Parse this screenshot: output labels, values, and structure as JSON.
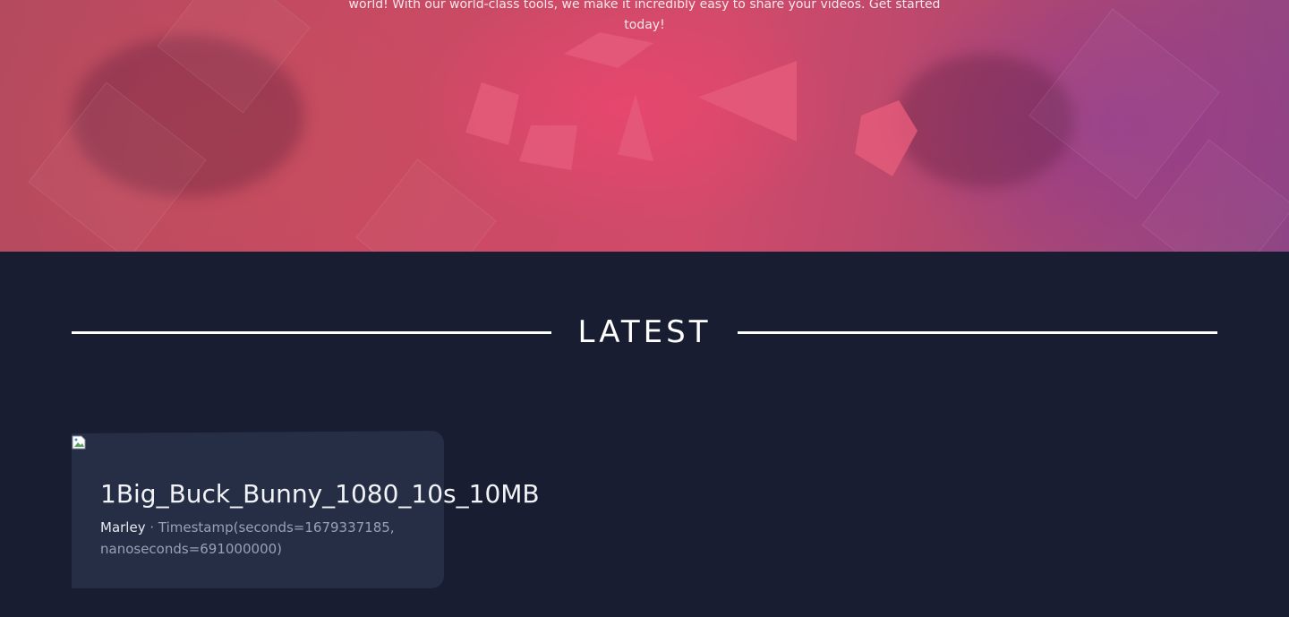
{
  "hero": {
    "description_line1": "world! With our world-class tools, we make it incredibly easy to share your videos. Get started",
    "description_line2": "today!"
  },
  "latest": {
    "heading": "LATEST"
  },
  "videos": [
    {
      "title": "1Big_Buck_Bunny_1080_10s_10MB",
      "author": "Marley",
      "separator": " · ",
      "timestamp": "Timestamp(seconds=1679337185, nanoseconds=691000000)",
      "thumbnail_icon": "broken-image-icon"
    }
  ],
  "colors": {
    "page_background": "#181d31",
    "card_background": "#262e46",
    "hero_accent": "#d14a6a",
    "hero_purple": "#8e4585"
  }
}
